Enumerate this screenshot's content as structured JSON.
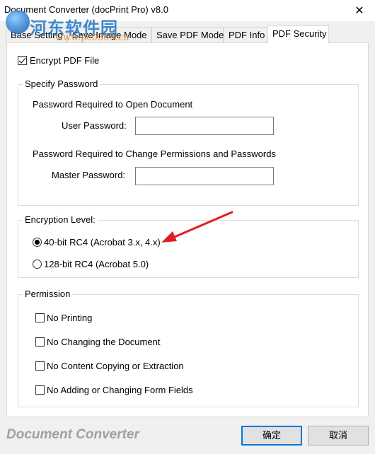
{
  "window": {
    "title": "Document Converter (docPrint Pro) v8.0",
    "close_glyph": "✕"
  },
  "watermark": {
    "text": "河东软件园",
    "url": "www.pc0359.cn"
  },
  "tabs": [
    {
      "label": "Base Setting",
      "active": false
    },
    {
      "label": "Save Image Mode",
      "active": false
    },
    {
      "label": "Save PDF Mode",
      "active": false
    },
    {
      "label": "PDF Info",
      "active": false
    },
    {
      "label": "PDF Security",
      "active": true
    }
  ],
  "encrypt": {
    "label": "Encrypt PDF File",
    "checked": true
  },
  "password_group": {
    "title": "Specify Password",
    "open_heading": "Password Required to Open Document",
    "user_label": "User Password:",
    "user_value": "",
    "perm_heading": "Password Required to Change Permissions and Passwords",
    "master_label": "Master Password:",
    "master_value": ""
  },
  "encryption_group": {
    "title": "Encryption Level:",
    "options": [
      {
        "label": "40-bit RC4 (Acrobat 3.x, 4.x)",
        "selected": true
      },
      {
        "label": "128-bit RC4 (Acrobat 5.0)",
        "selected": false
      }
    ]
  },
  "permission_group": {
    "title": "Permission",
    "options": [
      {
        "label": "No Printing",
        "checked": false
      },
      {
        "label": "No Changing the Document",
        "checked": false
      },
      {
        "label": "No Content Copying or Extraction",
        "checked": false
      },
      {
        "label": "No Adding or Changing Form Fields",
        "checked": false
      }
    ]
  },
  "footer": {
    "brand": "Document Converter",
    "ok_label": "确定",
    "cancel_label": "取消"
  },
  "colors": {
    "accent": "#0078d7",
    "annotation_arrow": "#e02020"
  }
}
